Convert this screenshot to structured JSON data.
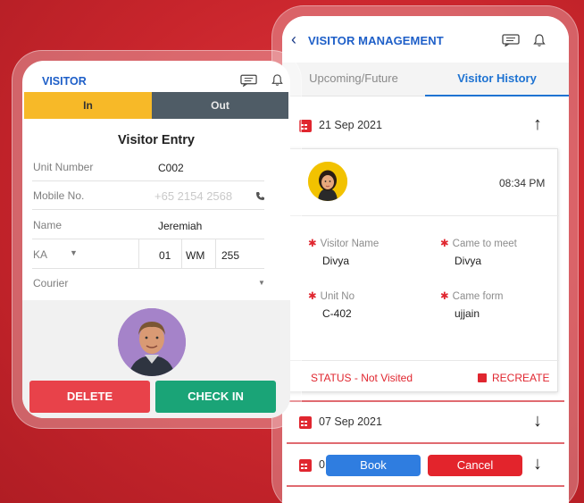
{
  "right_app": {
    "title": "VISITOR MANAGEMENT",
    "tabs": [
      "Upcoming/Future",
      "Visitor History"
    ],
    "dates": [
      "21 Sep 2021",
      "07 Sep 2021",
      "0"
    ],
    "card": {
      "time": "08:34 PM",
      "visitor_name_label": "Visitor Name",
      "visitor_name": "Divya",
      "came_to_meet_label": "Came to meet",
      "came_to_meet": "Divya",
      "unit_no_label": "Unit No",
      "unit_no": "C-402",
      "came_from_label": "Came form",
      "came_from": "ujjain",
      "status": "STATUS - Not Visited",
      "recreate": "RECREATE"
    },
    "book_label": "Book",
    "cancel_label": "Cancel"
  },
  "left_app": {
    "title": "VISITOR",
    "seg_in": "In",
    "seg_out": "Out",
    "form_title": "Visitor Entry",
    "unit_number_label": "Unit Number",
    "unit_number_value": "C002",
    "mobile_label": "Mobile No.",
    "mobile_value": "+65 2154 2568",
    "name_label": "Name",
    "name_value": "Jeremiah",
    "plate_state": "KA",
    "plate_1": "01",
    "plate_2": "WM",
    "plate_3": "255",
    "courier_label": "Courier",
    "delete_label": "DELETE",
    "checkin_label": "CHECK IN"
  },
  "colors": {
    "background_red": "#c8252c",
    "accent_blue": "#1e5fc8",
    "status_red": "#e0262f",
    "in_yellow": "#f7b928",
    "out_gray": "#4f5c66",
    "checkin_green": "#1aa477",
    "delete_red": "#e8424a"
  },
  "icons": [
    "back-chevron-icon",
    "message-icon",
    "bell-icon",
    "calendar-icon",
    "arrow-up-icon",
    "arrow-down-icon",
    "phone-icon",
    "dropdown-icon",
    "recreate-icon"
  ]
}
